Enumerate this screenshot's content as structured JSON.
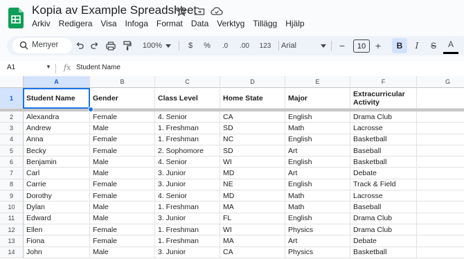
{
  "title": "Kopia av Example Spreadsheet",
  "menu": [
    "Arkiv",
    "Redigera",
    "Visa",
    "Infoga",
    "Format",
    "Data",
    "Verktyg",
    "Tillägg",
    "Hjälp"
  ],
  "toolbar": {
    "search_label": "Menyer",
    "zoom": "100%",
    "currency": "$",
    "percent": "%",
    "decrease_decimal": ".0",
    "increase_decimal": ".00",
    "number_format": "123",
    "font": "Arial",
    "font_size": "10",
    "minus": "−",
    "plus": "+",
    "bold": "B",
    "italic": "I",
    "strike": "S",
    "text_color": "A"
  },
  "formula_bar": {
    "cell_ref": "A1",
    "fx": "fx",
    "value": "Student Name"
  },
  "columns": [
    "A",
    "B",
    "C",
    "D",
    "E",
    "F",
    "G"
  ],
  "header_row": {
    "number": "1",
    "cells": [
      "Student Name",
      "Gender",
      "Class Level",
      "Home State",
      "Major",
      "Extracurricular Activity"
    ]
  },
  "rows": [
    {
      "n": "2",
      "cells": [
        "Alexandra",
        "Female",
        "4. Senior",
        "CA",
        "English",
        "Drama Club"
      ]
    },
    {
      "n": "3",
      "cells": [
        "Andrew",
        "Male",
        "1. Freshman",
        "SD",
        "Math",
        "Lacrosse"
      ]
    },
    {
      "n": "4",
      "cells": [
        "Anna",
        "Female",
        "1. Freshman",
        "NC",
        "English",
        "Basketball"
      ]
    },
    {
      "n": "5",
      "cells": [
        "Becky",
        "Female",
        "2. Sophomore",
        "SD",
        "Art",
        "Baseball"
      ]
    },
    {
      "n": "6",
      "cells": [
        "Benjamin",
        "Male",
        "4. Senior",
        "WI",
        "English",
        "Basketball"
      ]
    },
    {
      "n": "7",
      "cells": [
        "Carl",
        "Male",
        "3. Junior",
        "MD",
        "Art",
        "Debate"
      ]
    },
    {
      "n": "8",
      "cells": [
        "Carrie",
        "Female",
        "3. Junior",
        "NE",
        "English",
        "Track & Field"
      ]
    },
    {
      "n": "9",
      "cells": [
        "Dorothy",
        "Female",
        "4. Senior",
        "MD",
        "Math",
        "Lacrosse"
      ]
    },
    {
      "n": "10",
      "cells": [
        "Dylan",
        "Male",
        "1. Freshman",
        "MA",
        "Math",
        "Baseball"
      ]
    },
    {
      "n": "11",
      "cells": [
        "Edward",
        "Male",
        "3. Junior",
        "FL",
        "English",
        "Drama Club"
      ]
    },
    {
      "n": "12",
      "cells": [
        "Ellen",
        "Female",
        "1. Freshman",
        "WI",
        "Physics",
        "Drama Club"
      ]
    },
    {
      "n": "13",
      "cells": [
        "Fiona",
        "Female",
        "1. Freshman",
        "MA",
        "Art",
        "Debate"
      ]
    },
    {
      "n": "14",
      "cells": [
        "John",
        "Male",
        "3. Junior",
        "CA",
        "Physics",
        "Basketball"
      ]
    }
  ],
  "colors": {
    "selection": "#1a73e8",
    "highlight": "#f49648",
    "sheets_green": "#0f9d58"
  }
}
